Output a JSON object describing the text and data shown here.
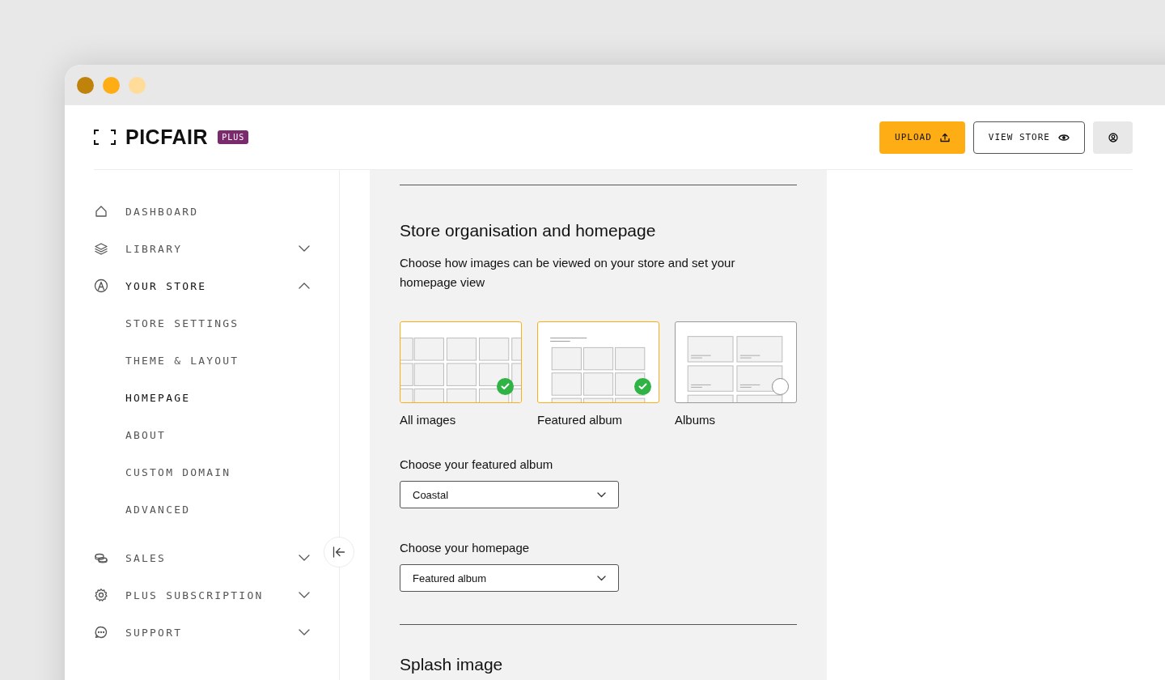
{
  "window": {
    "controls": [
      {
        "color": "#bf830c"
      },
      {
        "color": "#ffad14"
      },
      {
        "color": "#ffdc9a"
      }
    ]
  },
  "brand": {
    "name": "PICFAIR",
    "badge": "PLUS"
  },
  "header_actions": [
    {
      "kind": "upload",
      "label": "UPLOAD"
    },
    {
      "kind": "view",
      "label": "VIEW STORE"
    },
    {
      "kind": "account"
    }
  ],
  "sidebar": {
    "items": [
      {
        "kind": "home",
        "label": "DASHBOARD",
        "selected": false
      },
      {
        "kind": "layers",
        "label": "LIBRARY",
        "selected": false,
        "expanded": false
      },
      {
        "kind": "store",
        "label": "YOUR STORE",
        "selected": true,
        "expanded": true,
        "children": [
          {
            "label": "STORE SETTINGS",
            "selected": false
          },
          {
            "label": "THEME & LAYOUT",
            "selected": false
          },
          {
            "label": "HOMEPAGE",
            "selected": true
          },
          {
            "label": "ABOUT",
            "selected": false
          },
          {
            "label": "CUSTOM DOMAIN",
            "selected": false
          },
          {
            "label": "ADVANCED",
            "selected": false
          }
        ]
      },
      {
        "kind": "coins",
        "label": "SALES",
        "selected": false,
        "expanded": false
      },
      {
        "kind": "gear",
        "label": "PLUS SUBSCRIPTION",
        "selected": false,
        "expanded": false
      },
      {
        "kind": "chat",
        "label": "SUPPORT",
        "selected": false,
        "expanded": false
      }
    ]
  },
  "section": {
    "title": "Store organisation and homepage",
    "description": "Choose how images can be viewed on your store and set your homepage view",
    "layout_options": [
      {
        "kind": "grid",
        "label": "All images",
        "selected": true
      },
      {
        "kind": "featured",
        "label": "Featured album",
        "selected": true
      },
      {
        "kind": "albums",
        "label": "Albums",
        "selected": false
      }
    ],
    "selects": [
      {
        "label": "Choose your featured album",
        "value": "Coastal"
      },
      {
        "label": "Choose your homepage",
        "value": "Featured album"
      }
    ]
  },
  "next_section": {
    "title": "Splash image"
  }
}
